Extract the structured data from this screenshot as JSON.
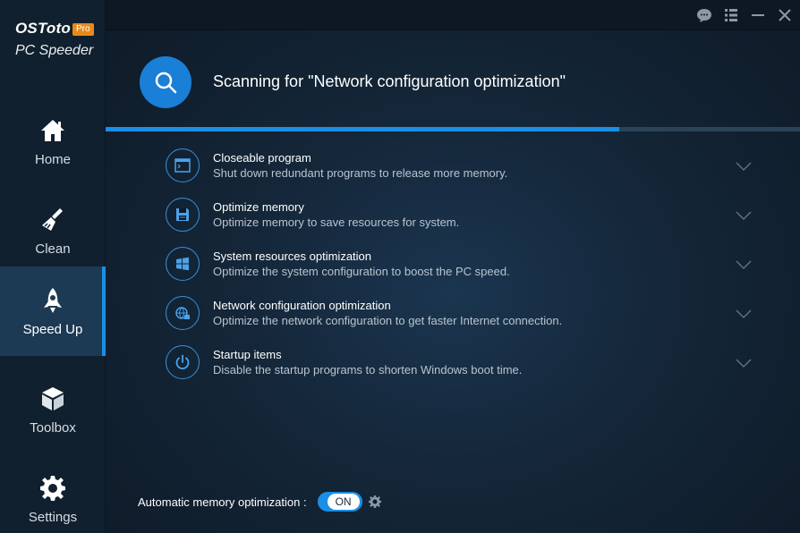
{
  "brand": {
    "name": "OSToto",
    "badge": "Pro",
    "subtitle": "PC Speeder"
  },
  "sidebar": {
    "items": [
      {
        "label": "Home",
        "icon": "home-icon"
      },
      {
        "label": "Clean",
        "icon": "broom-icon"
      },
      {
        "label": "Speed Up",
        "icon": "rocket-icon",
        "active": true
      },
      {
        "label": "Toolbox",
        "icon": "toolbox-icon"
      },
      {
        "label": "Settings",
        "icon": "gear-icon"
      }
    ]
  },
  "window_controls": [
    "feedback-icon",
    "menu-icon",
    "minimize-icon",
    "close-icon"
  ],
  "scan": {
    "title": "Scanning for \"Network configuration optimization\"",
    "progress": 0.74
  },
  "items": [
    {
      "title": "Closeable program",
      "desc": "Shut down redundant programs to release more memory.",
      "icon": "program-window-icon"
    },
    {
      "title": "Optimize memory",
      "desc": "Optimize memory to save resources for system.",
      "icon": "memory-icon"
    },
    {
      "title": "System resources optimization",
      "desc": "Optimize the system configuration to boost the PC speed.",
      "icon": "windows-logo-icon"
    },
    {
      "title": "Network configuration optimization",
      "desc": "Optimize the network configuration to get faster Internet connection.",
      "icon": "network-icon"
    },
    {
      "title": "Startup items",
      "desc": "Disable the startup programs to shorten Windows boot time.",
      "icon": "power-icon"
    }
  ],
  "footer": {
    "label": "Automatic memory optimization :",
    "toggle": "ON"
  },
  "colors": {
    "accent": "#1b8fe6",
    "badge": "#e88a1a",
    "sidebar": "#11202e",
    "active_nav": "#1d3a54"
  }
}
